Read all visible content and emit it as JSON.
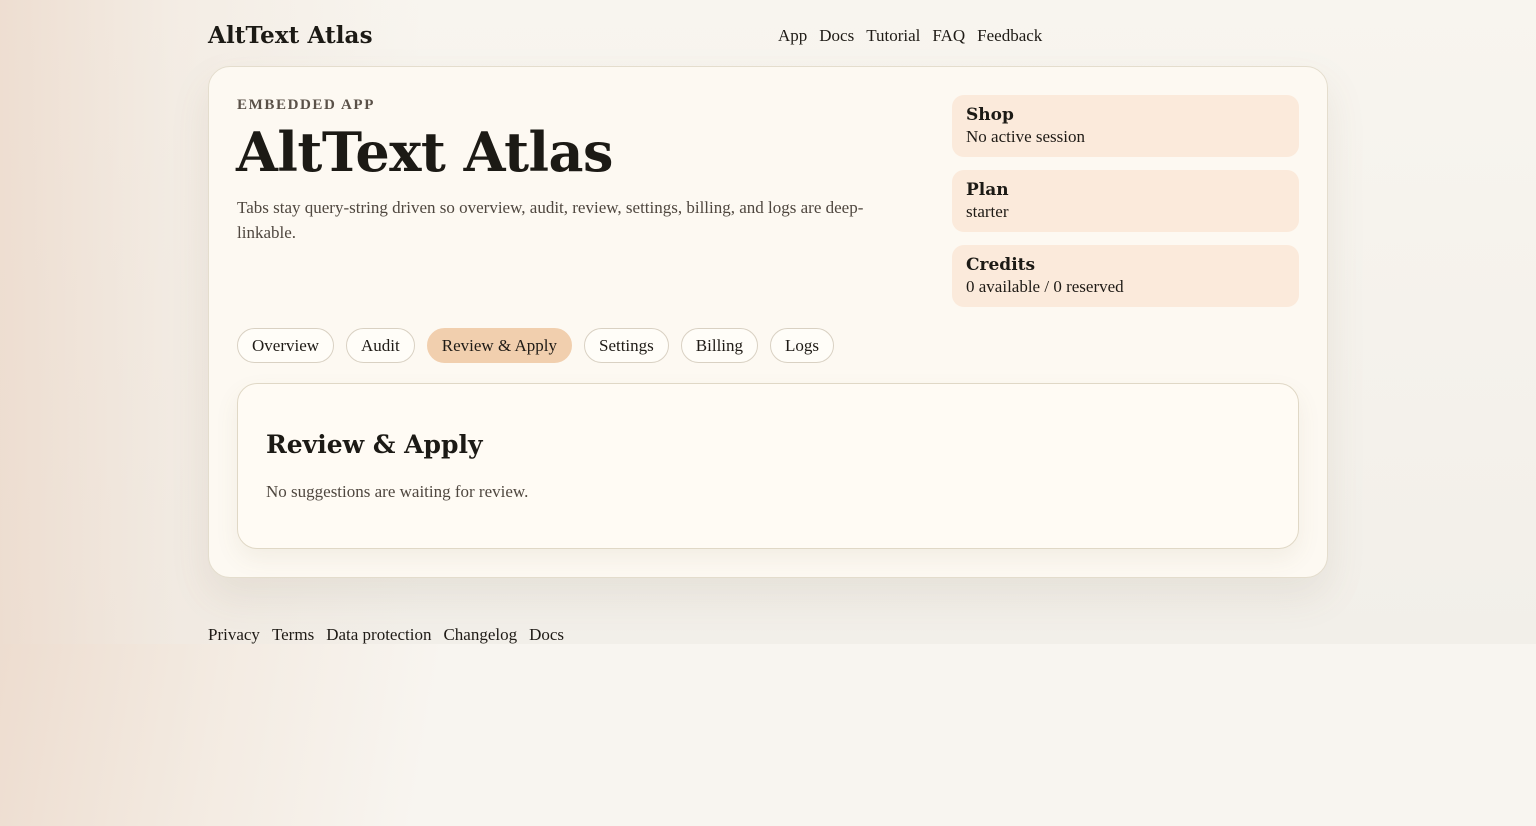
{
  "header": {
    "brand": "AltText Atlas",
    "nav": [
      "App",
      "Docs",
      "Tutorial",
      "FAQ",
      "Feedback"
    ]
  },
  "hero": {
    "eyebrow": "EMBEDDED APP",
    "title": "AltText Atlas",
    "description": "Tabs stay query-string driven so overview, audit, review, settings, billing, and logs are deep-linkable."
  },
  "stats": [
    {
      "label": "Shop",
      "value": "No active session"
    },
    {
      "label": "Plan",
      "value": "starter"
    },
    {
      "label": "Credits",
      "value": "0 available / 0 reserved"
    }
  ],
  "tabs": [
    {
      "label": "Overview",
      "active": false
    },
    {
      "label": "Audit",
      "active": false
    },
    {
      "label": "Review & Apply",
      "active": true
    },
    {
      "label": "Settings",
      "active": false
    },
    {
      "label": "Billing",
      "active": false
    },
    {
      "label": "Logs",
      "active": false
    }
  ],
  "panel": {
    "title": "Review & Apply",
    "body": "No suggestions are waiting for review."
  },
  "footer": {
    "links": [
      "Privacy",
      "Terms",
      "Data protection",
      "Changelog",
      "Docs"
    ]
  },
  "colors": {
    "accent_tab": "#f1cfae",
    "stat_bg": "#fbeadb",
    "card_bg": "#fdf9f2"
  }
}
